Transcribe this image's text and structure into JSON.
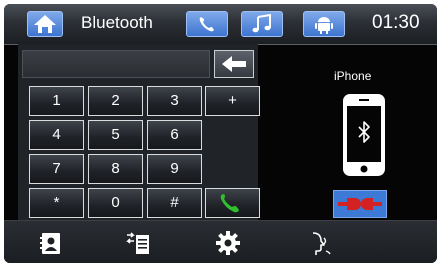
{
  "header": {
    "title": "Bluetooth",
    "time": "01:30",
    "tabs": [
      "phone-icon",
      "music-note-icon",
      "android-icon"
    ]
  },
  "keypad": {
    "display_value": "",
    "keys": [
      "1",
      "2",
      "3",
      "+",
      "4",
      "5",
      "6",
      "7",
      "8",
      "9",
      "*",
      "0",
      "#"
    ]
  },
  "device": {
    "name": "iPhone"
  },
  "bottom_nav": [
    "contacts-icon",
    "call-log-icon",
    "settings-icon",
    "voice-dial-icon"
  ],
  "colors": {
    "accent_blue": "#4a82dc",
    "call_green": "#2fbf2f",
    "disconnect_red": "#d42121"
  }
}
